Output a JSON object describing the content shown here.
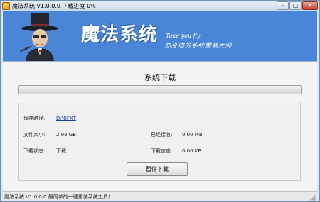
{
  "window": {
    "title": "魔法系统 V1.0.0.0 下载进度 0%",
    "controls": {
      "minimize": "–",
      "maximize": "□",
      "close": "✕"
    }
  },
  "banner": {
    "title": "魔法系统",
    "slogan_en": "Take you fly",
    "slogan_cn": "你身边的系统重装大师",
    "background": "#4a86d7"
  },
  "main": {
    "heading": "系统下载",
    "progress_fraction": 0.0
  },
  "info": {
    "save_path_label": "保存路径:",
    "save_path_value": "D:\\BFXT",
    "file_size_label": "文件大小:",
    "file_size_value": "2.98 GB",
    "received_label": "已经接收:",
    "received_value": "0.00 MB",
    "status_label": "下载状态:",
    "status_value": "下载",
    "speed_label": "下载速度:",
    "speed_value": "0.00 KB"
  },
  "buttons": {
    "pause": "暂停下载"
  },
  "statusbar": {
    "text": "魔法系统 V1.0.0.0 最简单的一键重装系统工具！"
  }
}
